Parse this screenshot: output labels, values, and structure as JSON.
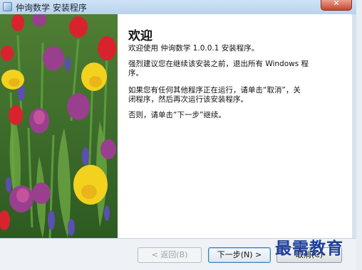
{
  "window": {
    "title": "仲询数学 安装程序"
  },
  "content": {
    "heading": "欢迎",
    "line1": "欢迎使用 仲询数学 1.0.0.1 安装程序。",
    "line2a": "强烈建议您在继续该安装之前，退出所有 Windows 程",
    "line2b": "序。",
    "line3a": "如果您有任何其他程序正在运行，请单击“取消”，关",
    "line3b": "闭程序，然后再次运行该安装程序。",
    "line4": "否则，请单击“下一步”继续。"
  },
  "buttons": {
    "back": "< 返回(B)",
    "next": "下一步(N) >",
    "cancel": "取消(C)"
  },
  "watermark": "最需教育",
  "colors": {
    "accent": "#3c7fb1",
    "watermark": "#1f3f9a"
  }
}
